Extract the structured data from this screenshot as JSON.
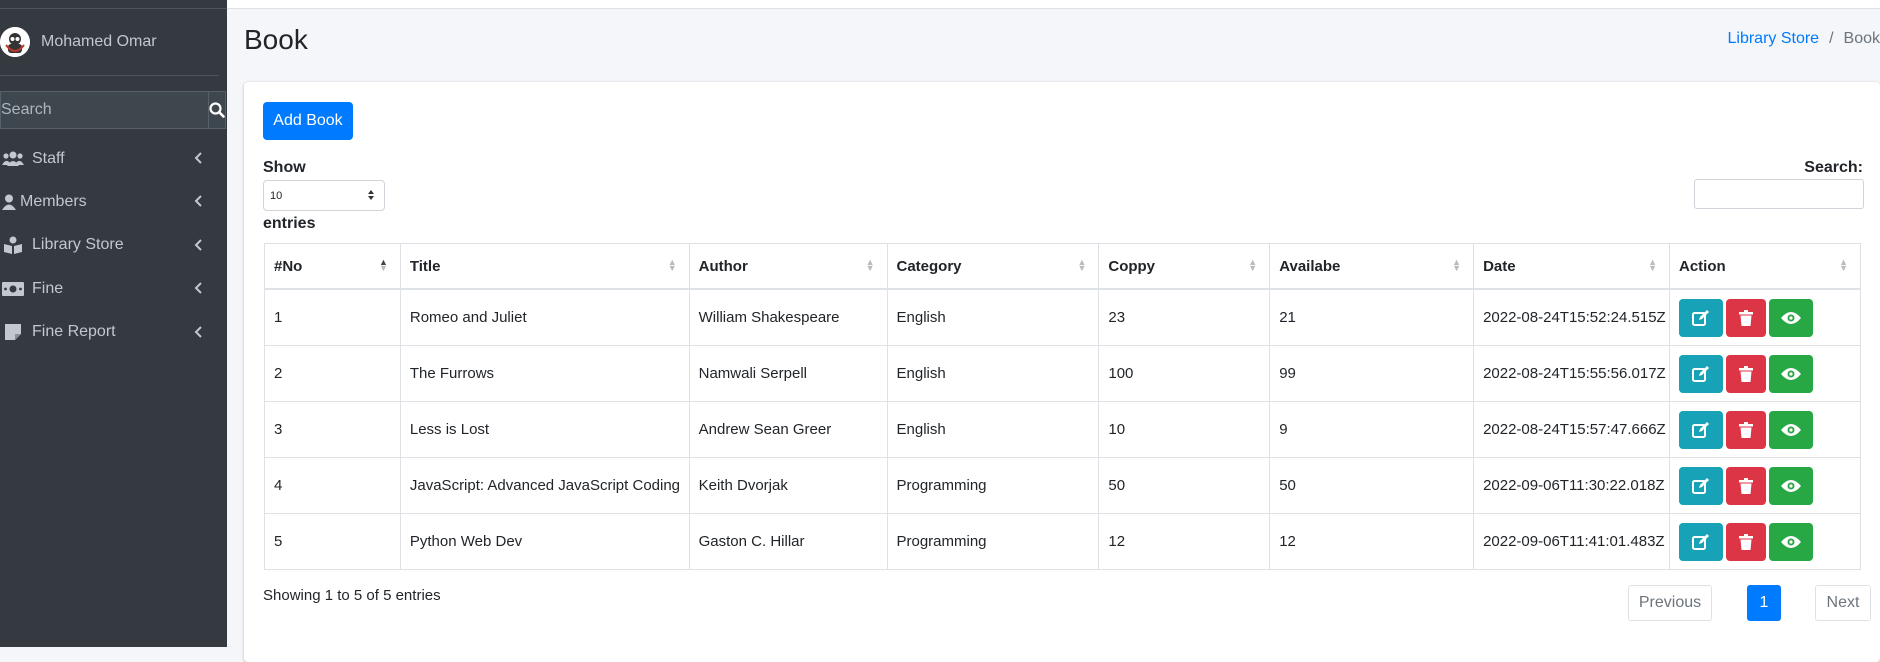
{
  "sidebar": {
    "user_name": "Mohamed Omar",
    "search_placeholder": "Search",
    "items": [
      {
        "label": "Staff",
        "icon": "users-icon"
      },
      {
        "label": "Members",
        "icon": "user-icon"
      },
      {
        "label": "Library Store",
        "icon": "book-reader-icon"
      },
      {
        "label": "Fine",
        "icon": "money-bill-icon"
      },
      {
        "label": "Fine Report",
        "icon": "sticky-note-icon"
      }
    ]
  },
  "header": {
    "title": "Book",
    "breadcrumb": {
      "link": "Library Store",
      "separator": "/",
      "active": "Book"
    }
  },
  "card": {
    "add_button": "Add Book",
    "show_label": "Show",
    "length_value": "10",
    "entries_label": "entries",
    "search_label": "Search:"
  },
  "table": {
    "columns": [
      "#No",
      "Title",
      "Author",
      "Category",
      "Coppy",
      "Availabe",
      "Date",
      "Action"
    ],
    "rows": [
      {
        "no": "1",
        "title": "Romeo and Juliet",
        "author": "William Shakespeare",
        "category": "English",
        "copy": "23",
        "available": "21",
        "date": "2022-08-24T15:52:24.515Z"
      },
      {
        "no": "2",
        "title": "The Furrows",
        "author": "Namwali Serpell",
        "category": "English",
        "copy": "100",
        "available": "99",
        "date": "2022-08-24T15:55:56.017Z"
      },
      {
        "no": "3",
        "title": "Less is Lost",
        "author": "Andrew Sean Greer",
        "category": "English",
        "copy": "10",
        "available": "9",
        "date": "2022-08-24T15:57:47.666Z"
      },
      {
        "no": "4",
        "title": "JavaScript: Advanced JavaScript Coding",
        "author": "Keith Dvorjak",
        "category": "Programming",
        "copy": "50",
        "available": "50",
        "date": "2022-09-06T11:30:22.018Z"
      },
      {
        "no": "5",
        "title": "Python Web Dev",
        "author": "Gaston C. Hillar",
        "category": "Programming",
        "copy": "12",
        "available": "12",
        "date": "2022-09-06T11:41:01.483Z"
      }
    ]
  },
  "footer": {
    "info": "Showing 1 to 5 of 5 entries",
    "previous": "Previous",
    "page": "1",
    "next": "Next"
  },
  "colors": {
    "primary": "#007bff",
    "edit": "#17a2b8",
    "delete": "#dc3545",
    "view": "#28a745",
    "sidebar": "#343a40"
  }
}
